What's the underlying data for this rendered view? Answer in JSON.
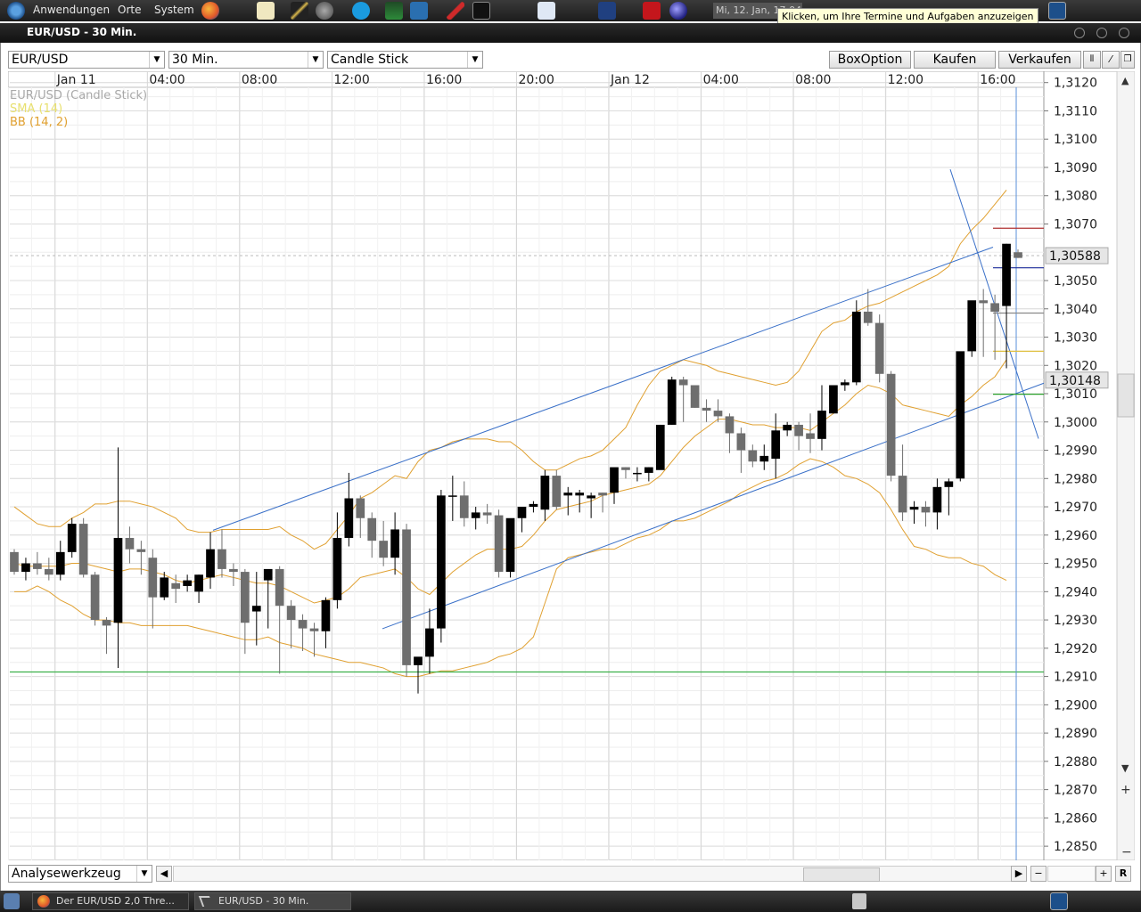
{
  "topbar": {
    "menus": [
      "Anwendungen",
      "Orte",
      "System"
    ],
    "clock": "Mi, 12. Jan, 17:04",
    "tooltip": "Klicken, um Ihre Termine und Aufgaben anzuzeigen"
  },
  "window": {
    "title": "EUR/USD - 30 Min."
  },
  "toolbar": {
    "symbol": "EUR/USD",
    "interval": "30 Min.",
    "chart_type": "Candle Stick",
    "box_option": "BoxOption",
    "buy": "Kaufen",
    "sell": "Verkaufen"
  },
  "bottombar": {
    "analysis_tool": "Analysewerkzeug",
    "reset": "R"
  },
  "taskbar": {
    "tasks": [
      "Der EUR/USD 2,0 Thre...",
      "EUR/USD - 30 Min."
    ]
  },
  "colors": {
    "sma": "#e8e070",
    "bb": "#e0a030",
    "trendline": "#3a70c8",
    "bull": "#000000",
    "bear": "#6e6e6e"
  },
  "chart_data": {
    "type": "candlestick",
    "legend": [
      "EUR/USD (Candle Stick)",
      "SMA (14)",
      "BB (14, 2)"
    ],
    "x_ticks": [
      "Jan 11",
      "04:00",
      "08:00",
      "12:00",
      "16:00",
      "20:00",
      "Jan 12",
      "04:00",
      "08:00",
      "12:00",
      "16:00"
    ],
    "y_ticks": [
      "1,3120",
      "1,3110",
      "1,3100",
      "1,3090",
      "1,3080",
      "1,3070",
      "1,3050",
      "1,3040",
      "1,3030",
      "1,3020",
      "1,3010",
      "1,3000",
      "1,2990",
      "1,2980",
      "1,2970",
      "1,2960",
      "1,2950",
      "1,2940",
      "1,2930",
      "1,2920",
      "1,2910",
      "1,2900",
      "1,2890",
      "1,2880",
      "1,2870",
      "1,2860",
      "1,2850"
    ],
    "y_range": [
      1.2845,
      1.3124
    ],
    "price_labels": [
      "1,30588",
      "1,30148"
    ],
    "candles": [
      [
        1.2954,
        1.2955,
        1.2946,
        1.2947
      ],
      [
        1.2947,
        1.2952,
        1.2944,
        1.295
      ],
      [
        1.295,
        1.2954,
        1.2946,
        1.2948
      ],
      [
        1.2948,
        1.2952,
        1.2944,
        1.2946
      ],
      [
        1.2946,
        1.2958,
        1.2944,
        1.2954
      ],
      [
        1.2954,
        1.2966,
        1.2952,
        1.2964
      ],
      [
        1.2964,
        1.2966,
        1.2945,
        1.2946
      ],
      [
        1.2946,
        1.2947,
        1.2928,
        1.293
      ],
      [
        1.293,
        1.2931,
        1.2918,
        1.2928
      ],
      [
        1.2929,
        1.2991,
        1.2913,
        1.2959
      ],
      [
        1.2959,
        1.2963,
        1.295,
        1.2955
      ],
      [
        1.2955,
        1.2958,
        1.2946,
        1.2954
      ],
      [
        1.2952,
        1.2955,
        1.2927,
        1.2938
      ],
      [
        1.2938,
        1.2947,
        1.2937,
        1.2945
      ],
      [
        1.2943,
        1.2946,
        1.2936,
        1.2941
      ],
      [
        1.2942,
        1.2946,
        1.294,
        1.2944
      ],
      [
        1.294,
        1.2946,
        1.2936,
        1.2946
      ],
      [
        1.2945,
        1.2961,
        1.2941,
        1.2955
      ],
      [
        1.2955,
        1.2962,
        1.2945,
        1.2948
      ],
      [
        1.2948,
        1.295,
        1.2942,
        1.2947
      ],
      [
        1.2947,
        1.2948,
        1.2918,
        1.2929
      ],
      [
        1.2933,
        1.2947,
        1.2921,
        1.2935
      ],
      [
        1.2944,
        1.2947,
        1.2927,
        1.2948
      ],
      [
        1.2948,
        1.2949,
        1.2911,
        1.2935
      ],
      [
        1.2935,
        1.2937,
        1.292,
        1.293
      ],
      [
        1.293,
        1.2932,
        1.2919,
        1.2927
      ],
      [
        1.2927,
        1.2929,
        1.2917,
        1.2926
      ],
      [
        1.2926,
        1.2938,
        1.292,
        1.2937
      ],
      [
        1.2937,
        1.2968,
        1.2934,
        1.2959
      ],
      [
        1.2959,
        1.2982,
        1.2956,
        1.2973
      ],
      [
        1.2973,
        1.2974,
        1.2959,
        1.2966
      ],
      [
        1.2966,
        1.2968,
        1.2952,
        1.2958
      ],
      [
        1.2958,
        1.2965,
        1.2949,
        1.2952
      ],
      [
        1.2952,
        1.2968,
        1.2946,
        1.2962
      ],
      [
        1.2962,
        1.2964,
        1.291,
        1.2914
      ],
      [
        1.2914,
        1.2916,
        1.2904,
        1.2917
      ],
      [
        1.2917,
        1.2934,
        1.2911,
        1.2927
      ],
      [
        1.2927,
        1.2976,
        1.2922,
        1.2974
      ],
      [
        1.2974,
        1.2981,
        1.2965,
        1.2974
      ],
      [
        1.2974,
        1.2979,
        1.2963,
        1.2966
      ],
      [
        1.2966,
        1.297,
        1.2962,
        1.2968
      ],
      [
        1.2968,
        1.2971,
        1.2964,
        1.2967
      ],
      [
        1.2967,
        1.2969,
        1.2945,
        1.2947
      ],
      [
        1.2947,
        1.2948,
        1.2945,
        1.2966
      ],
      [
        1.2966,
        1.2969,
        1.2961,
        1.297
      ],
      [
        1.297,
        1.2972,
        1.2968,
        1.2971
      ],
      [
        1.2969,
        1.2983,
        1.2965,
        1.2981
      ],
      [
        1.2981,
        1.2983,
        1.2969,
        1.297
      ],
      [
        1.2974,
        1.2977,
        1.2967,
        1.2975
      ],
      [
        1.2974,
        1.2976,
        1.2968,
        1.2975
      ],
      [
        1.2973,
        1.2975,
        1.2966,
        1.2974
      ],
      [
        1.2975,
        1.2975,
        1.2968,
        1.2974
      ],
      [
        1.2975,
        1.2983,
        1.2971,
        1.2984
      ],
      [
        1.2984,
        1.2984,
        1.298,
        1.2983
      ],
      [
        1.2982,
        1.2984,
        1.2979,
        1.2982
      ],
      [
        1.2982,
        1.2984,
        1.2979,
        1.2984
      ],
      [
        1.2983,
        1.2999,
        1.2984,
        1.2999
      ],
      [
        1.2999,
        1.3016,
        1.2999,
        1.3015
      ],
      [
        1.3015,
        1.3016,
        1.3,
        1.3013
      ],
      [
        1.3013,
        1.3013,
        1.3005,
        1.3005
      ],
      [
        1.3005,
        1.3008,
        1.3,
        1.3004
      ],
      [
        1.3004,
        1.3008,
        1.3,
        1.3002
      ],
      [
        1.3002,
        1.3003,
        1.2989,
        1.2996
      ],
      [
        1.2996,
        1.2998,
        1.2982,
        1.299
      ],
      [
        1.299,
        1.2992,
        1.2984,
        1.2986
      ],
      [
        1.2986,
        1.2992,
        1.2983,
        1.2988
      ],
      [
        1.2987,
        1.3003,
        1.298,
        1.2997
      ],
      [
        1.2997,
        1.3,
        1.2995,
        1.2999
      ],
      [
        1.2999,
        1.3,
        1.299,
        1.2995
      ],
      [
        1.2996,
        1.3003,
        1.2989,
        1.2994
      ],
      [
        1.2994,
        1.3013,
        1.299,
        1.3004
      ],
      [
        1.3003,
        1.3013,
        1.3003,
        1.3013
      ],
      [
        1.3013,
        1.3015,
        1.3011,
        1.3014
      ],
      [
        1.3014,
        1.3043,
        1.3013,
        1.3039
      ],
      [
        1.3039,
        1.3047,
        1.3034,
        1.3035
      ],
      [
        1.3035,
        1.3038,
        1.3014,
        1.3017
      ],
      [
        1.3017,
        1.3018,
        1.2979,
        1.2981
      ],
      [
        1.2981,
        1.2992,
        1.2965,
        1.2968
      ],
      [
        1.2969,
        1.2972,
        1.2964,
        1.297
      ],
      [
        1.297,
        1.2972,
        1.2963,
        1.2968
      ],
      [
        1.2968,
        1.298,
        1.2962,
        1.2977
      ],
      [
        1.2977,
        1.298,
        1.2967,
        1.2979
      ],
      [
        1.298,
        1.3017,
        1.2979,
        1.3025
      ],
      [
        1.3025,
        1.3042,
        1.3023,
        1.3043
      ],
      [
        1.3043,
        1.3047,
        1.3023,
        1.3042
      ],
      [
        1.3042,
        1.3045,
        1.3022,
        1.3039
      ],
      [
        1.3041,
        1.3063,
        1.3019,
        1.3063
      ],
      [
        1.306,
        1.3061,
        1.3058,
        1.3058
      ]
    ],
    "sma": [
      1.295,
      1.2949,
      1.2949,
      1.2949,
      1.2949,
      1.295,
      1.295,
      1.2949,
      1.2948,
      1.2947,
      1.2948,
      1.2948,
      1.2947,
      1.2946,
      1.2944,
      1.2943,
      1.2944,
      1.2945,
      1.2946,
      1.2945,
      1.2944,
      1.2943,
      1.2943,
      1.2942,
      1.294,
      1.2938,
      1.2936,
      1.2937,
      1.2938,
      1.2941,
      1.2945,
      1.2946,
      1.2947,
      1.2948,
      1.2945,
      1.2941,
      1.2939,
      1.2943,
      1.2947,
      1.295,
      1.2953,
      1.2955,
      1.2955,
      1.2955,
      1.2956,
      1.296,
      1.2965,
      1.2969,
      1.297,
      1.2971,
      1.2972,
      1.2974,
      1.2975,
      1.2976,
      1.2977,
      1.2978,
      1.2981,
      1.2986,
      1.2991,
      1.2995,
      1.2998,
      1.3001,
      1.3001,
      1.3,
      1.2999,
      1.2999,
      1.2998,
      1.2998,
      1.2998,
      1.2997,
      1.3,
      1.3003,
      1.3006,
      1.301,
      1.3013,
      1.3012,
      1.301,
      1.3006,
      1.3005,
      1.3004,
      1.3003,
      1.3002,
      1.3006,
      1.3009,
      1.3013,
      1.3016,
      1.3022
    ],
    "bb_upper": [
      1.297,
      1.2967,
      1.2964,
      1.2963,
      1.2963,
      1.2966,
      1.2968,
      1.2971,
      1.2971,
      1.2972,
      1.2972,
      1.2971,
      1.297,
      1.2968,
      1.2966,
      1.2962,
      1.2961,
      1.2961,
      1.2962,
      1.2962,
      1.2962,
      1.2962,
      1.2962,
      1.2963,
      1.296,
      1.2958,
      1.2955,
      1.2957,
      1.2962,
      1.2967,
      1.2973,
      1.2975,
      1.2978,
      1.2981,
      1.298,
      1.2986,
      1.299,
      1.2991,
      1.2993,
      1.2994,
      1.2994,
      1.2994,
      1.2993,
      1.2993,
      1.299,
      1.2986,
      1.2983,
      1.2983,
      1.2985,
      1.2987,
      1.2988,
      1.299,
      1.2994,
      1.2998,
      1.3006,
      1.3013,
      1.3018,
      1.302,
      1.3022,
      1.3021,
      1.302,
      1.3018,
      1.3017,
      1.3016,
      1.3015,
      1.3014,
      1.3013,
      1.3014,
      1.3018,
      1.3025,
      1.3032,
      1.3035,
      1.3036,
      1.3039,
      1.3041,
      1.3042,
      1.3044,
      1.3046,
      1.3048,
      1.305,
      1.3052,
      1.3055,
      1.3063,
      1.3068,
      1.3072,
      1.3077,
      1.3082
    ],
    "bb_lower": [
      1.294,
      1.294,
      1.2942,
      1.294,
      1.2937,
      1.2935,
      1.2932,
      1.293,
      1.293,
      1.2929,
      1.2929,
      1.2928,
      1.2928,
      1.2928,
      1.2928,
      1.2928,
      1.2927,
      1.2926,
      1.2925,
      1.2924,
      1.2923,
      1.2923,
      1.2924,
      1.2922,
      1.2921,
      1.292,
      1.2918,
      1.2917,
      1.2916,
      1.2915,
      1.2915,
      1.2914,
      1.2913,
      1.2911,
      1.291,
      1.291,
      1.2911,
      1.2912,
      1.2912,
      1.2913,
      1.2914,
      1.2915,
      1.2917,
      1.2918,
      1.292,
      1.2924,
      1.2936,
      1.2948,
      1.2952,
      1.2953,
      1.2954,
      1.2955,
      1.2955,
      1.2957,
      1.2959,
      1.296,
      1.2962,
      1.2965,
      1.2965,
      1.2966,
      1.2968,
      1.297,
      1.2972,
      1.2975,
      1.2977,
      1.2979,
      1.298,
      1.2982,
      1.2985,
      1.2987,
      1.2986,
      1.2984,
      1.2981,
      1.298,
      1.2978,
      1.2975,
      1.2969,
      1.2962,
      1.2956,
      1.2955,
      1.2953,
      1.2952,
      1.2952,
      1.295,
      1.2949,
      1.2946,
      1.2944
    ]
  }
}
